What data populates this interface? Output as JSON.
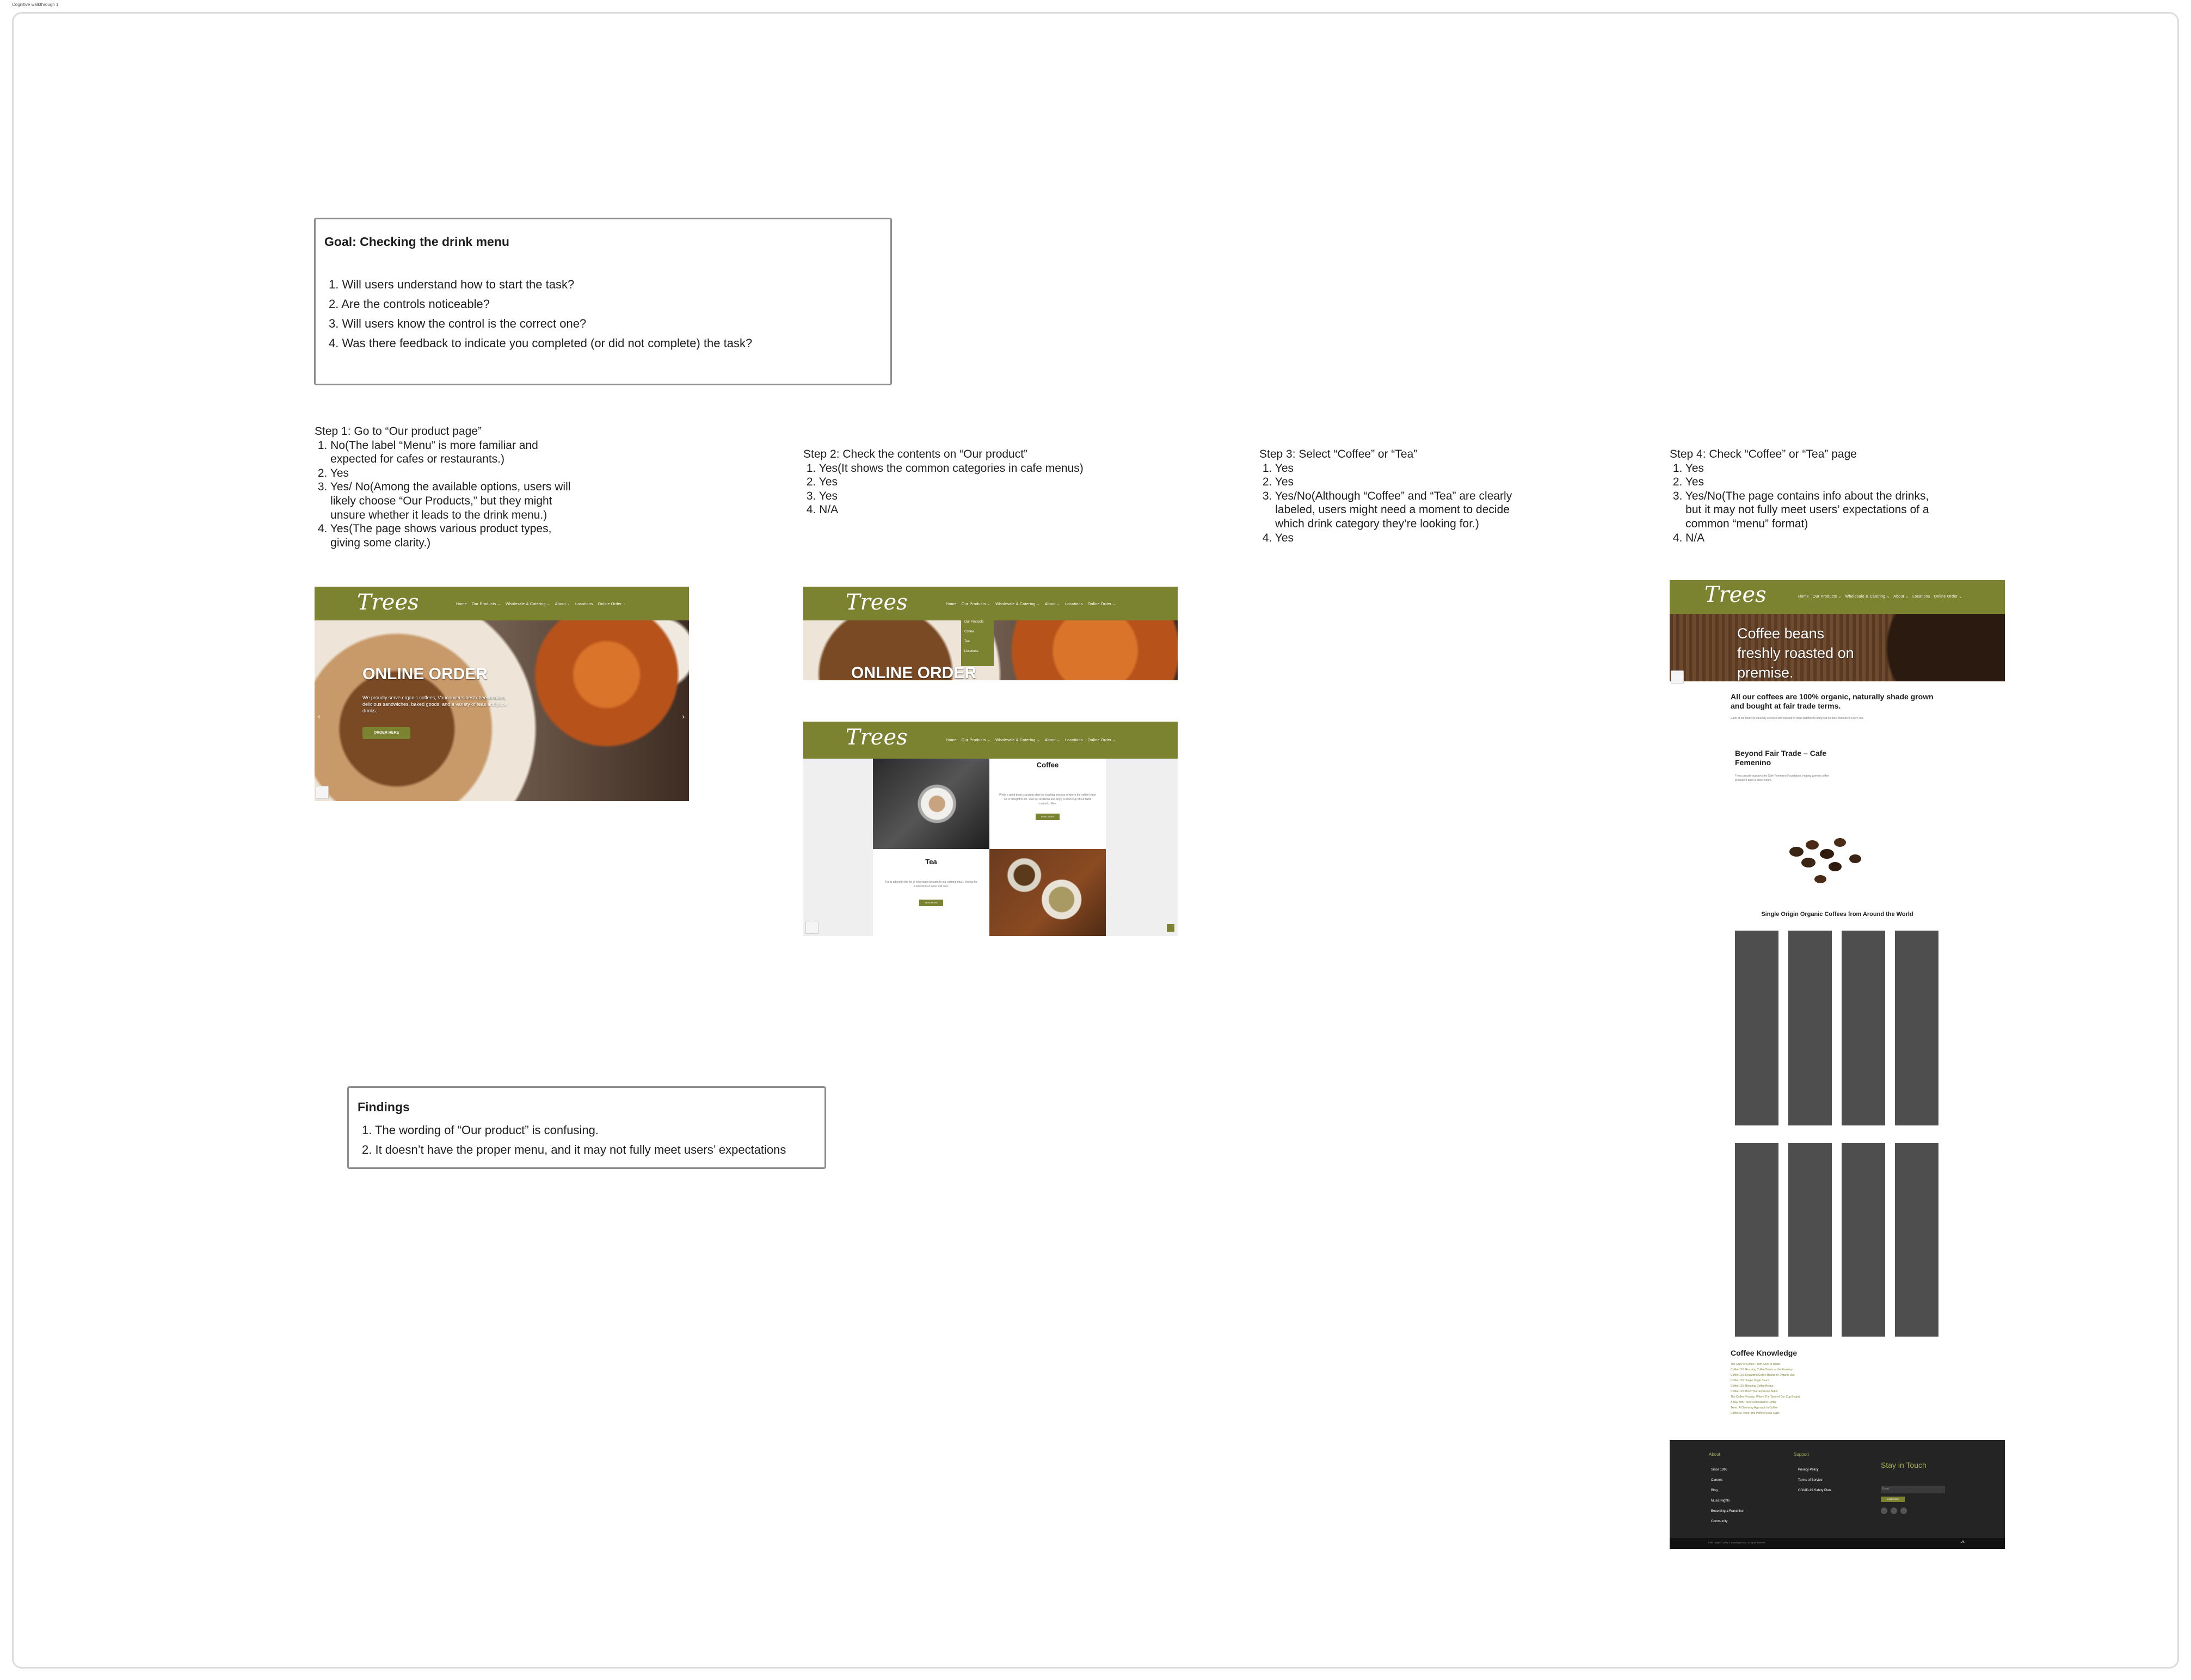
{
  "page": {
    "label": "Cognitive walkthrough 1"
  },
  "goal": {
    "title": "Goal: Checking the drink menu",
    "questions": [
      "Will users understand how to start the task?",
      "Are the controls noticeable?",
      "Will users know the control is the correct one?",
      "Was there feedback to indicate you completed (or did not complete) the task?"
    ]
  },
  "steps": [
    {
      "title": "Step 1: Go to “Our product page”",
      "lines": [
        " 1. No(The label “Menu” is more familiar and",
        "     expected for cafes or restaurants.)",
        " 2. Yes",
        " 3. Yes/ No(Among the available options, users will",
        "     likely choose “Our Products,” but they might",
        "     unsure whether it leads to the drink menu.)",
        " 4. Yes(The page shows various product types,",
        "     giving some clarity.)"
      ]
    },
    {
      "title": "Step 2: Check the contents on “Our product”",
      "lines": [
        " 1. Yes(It shows the common categories in cafe menus)",
        " 2. Yes",
        " 3. Yes",
        " 4. N/A"
      ]
    },
    {
      "title": "Step 3: Select “Coffee” or “Tea”",
      "lines": [
        " 1. Yes",
        " 2. Yes",
        " 3. Yes/No(Although “Coffee” and “Tea” are clearly",
        "     labeled, users might need a moment to decide",
        "     which drink category they’re looking for.)",
        " 4. Yes"
      ]
    },
    {
      "title": "Step 4: Check “Coffee” or “Tea” page",
      "lines": [
        " 1. Yes",
        " 2. Yes",
        " 3. Yes/No(The page contains info about the drinks,",
        "     but it may not fully meet users’ expectations of a",
        "     common “menu” format)",
        " 4. N/A"
      ]
    }
  ],
  "site": {
    "logo": "Trees",
    "nav": [
      "Home",
      "Our Products ⌄",
      "Wholesale & Catering ⌄",
      "About ⌄",
      "Locations",
      "Online Order ⌄"
    ],
    "dropdown": [
      "Our Products",
      "Coffee",
      "Tea",
      "Locations"
    ],
    "hero1": "ONLINE ORDER",
    "hero1_sub": "We proudly serve organic coffees, Vancouver's best cheesecakes, delicious sandwiches, baked goods, and a variety of teas and juice drinks.",
    "order_btn": "ORDER HERE",
    "coffee_title": "Coffee",
    "coffee_text": "While a good bean is a great start the roasting process is where the coffee's true art is brought to life. Visit our locations and enjoy a fresh cup of our hand roasted coffee.",
    "read_more": "READ MORE",
    "tea_title": "Tea",
    "tea_text": "Tea is added to the list of beverages brought to our calming ritual. Visit us for a selection of loose leaf teas.",
    "coffee_hero": "Coffee beans freshly roasted on premise.",
    "organic_heading": "All our coffees are 100% organic, naturally shade grown and bought at fair trade terms.",
    "organic_text": "Each of our beans is carefully selected and roasted in small batches to bring out the best flavours in every cup.",
    "fair_trade_title": "Beyond Fair Trade – Cafe Femenino",
    "fair_trade_text": "Trees proudly supports the Cafe Femenino Foundation, helping women coffee producers build a better future.",
    "single_origin": "Single Origin Organic Coffees from Around the World",
    "coffee_knowledge": "Coffee Knowledge",
    "knowledge_links": [
      "The Story of Coffee: From Seed to Roast",
      "Coffee 101: Roasting Coffee Beans at the Roastery",
      "Coffee 101: Decanting Coffee Beans for Organic Use",
      "Coffee 101: Single Origin Beans",
      "Coffee 101: Blending Coffee Beans",
      "Coffee 101: Brew Your Espresso Better",
      "The Coffee Process: Where The Taste of Our Cup Begins",
      "A Day with Trees: Dedicated to Coffee",
      "Trees: A Chemistry Approach to Coffee",
      "Coffee at Trees: The Perfect Swap Cups"
    ],
    "footer_col1_title": "About",
    "footer_col1": [
      "Since 1996",
      "Careers",
      "Blog",
      "Music Nights",
      "Becoming a Franchise",
      "Community"
    ],
    "footer_col2_title": "Support",
    "footer_col2": [
      "Privacy Policy",
      "Terms of Service",
      "COVID-19 Safety Plan"
    ],
    "stay_in_touch": "Stay in Touch",
    "email_placeholder": "Email",
    "subscribe": "SUBSCRIBE",
    "copyright": "Trees Organic Coffee & Roasting House. All rights reserved."
  },
  "findings": {
    "title": "Findings",
    "items": [
      "The wording of “Our product” is confusing.",
      "It doesn’t have the proper menu, and it may not fully meet users’ expectations"
    ]
  },
  "colors": {
    "olive": "#7c8330",
    "card": "#4e4e4e",
    "footer": "#242424"
  }
}
